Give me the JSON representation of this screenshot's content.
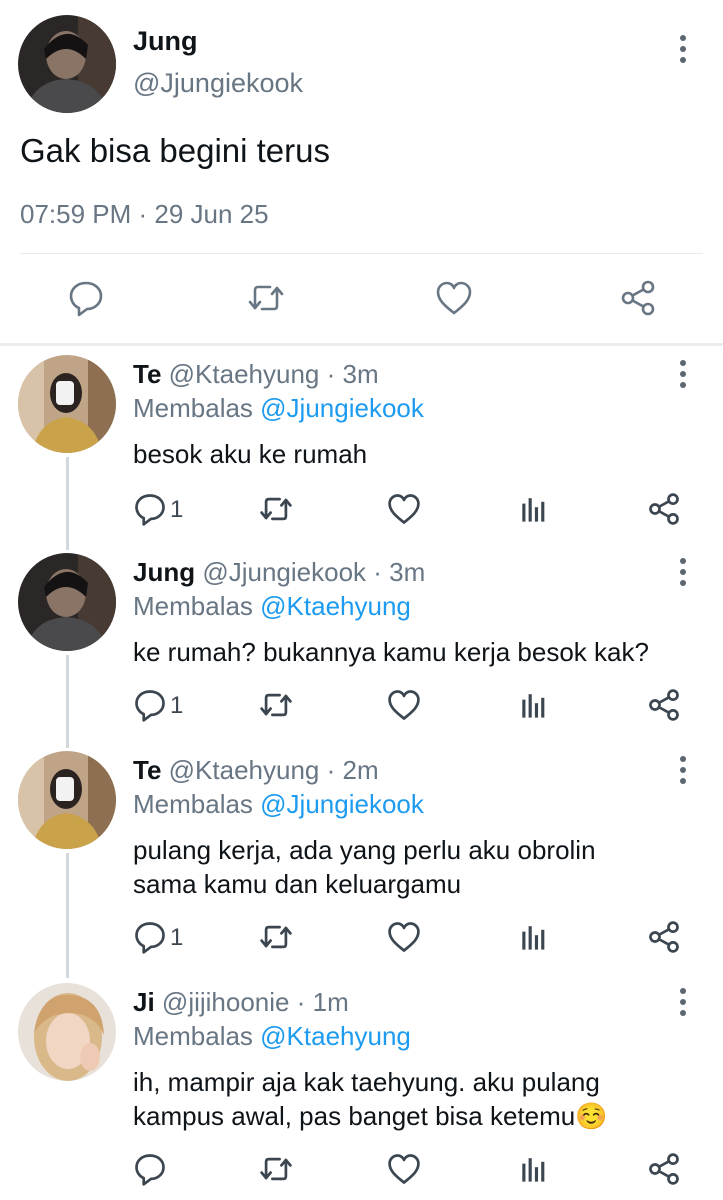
{
  "main_tweet": {
    "name": "Jung",
    "handle": "@Jjungiekook",
    "text": "Gak bisa begini terus",
    "timestamp": "07:59 PM · 29 Jun 25",
    "actions": [
      "reply-icon",
      "retweet-icon",
      "like-icon",
      "share-icon"
    ]
  },
  "replies": [
    {
      "name": "Te",
      "meta": "@Ktaehyung · 3m",
      "replying_prefix": "Membalas ",
      "replying_to": "@Jjungiekook",
      "text": "besok aku ke rumah",
      "reply_count": "1"
    },
    {
      "name": "Jung",
      "meta": "@Jjungiekook · 3m",
      "replying_prefix": "Membalas ",
      "replying_to": "@Ktaehyung",
      "text": "ke rumah? bukannya kamu kerja besok kak?",
      "reply_count": "1"
    },
    {
      "name": "Te",
      "meta": "@Ktaehyung · 2m",
      "replying_prefix": "Membalas ",
      "replying_to": "@Jjungiekook",
      "text": "pulang kerja, ada yang perlu aku obrolin sama kamu dan keluargamu",
      "reply_count": "1"
    },
    {
      "name": "Ji",
      "meta": "@jijihoonie · 1m",
      "replying_prefix": "Membalas ",
      "replying_to": "@Ktaehyung",
      "text": "ih, mampir aja kak taehyung. aku pulang kampus awal, pas banget bisa ketemu☺️",
      "reply_count": ""
    }
  ],
  "colors": {
    "text": "#0f1419",
    "secondary": "#687684",
    "link": "#1d9bf0",
    "divider": "#e6ecf0",
    "thread_line": "#cfd9de"
  }
}
